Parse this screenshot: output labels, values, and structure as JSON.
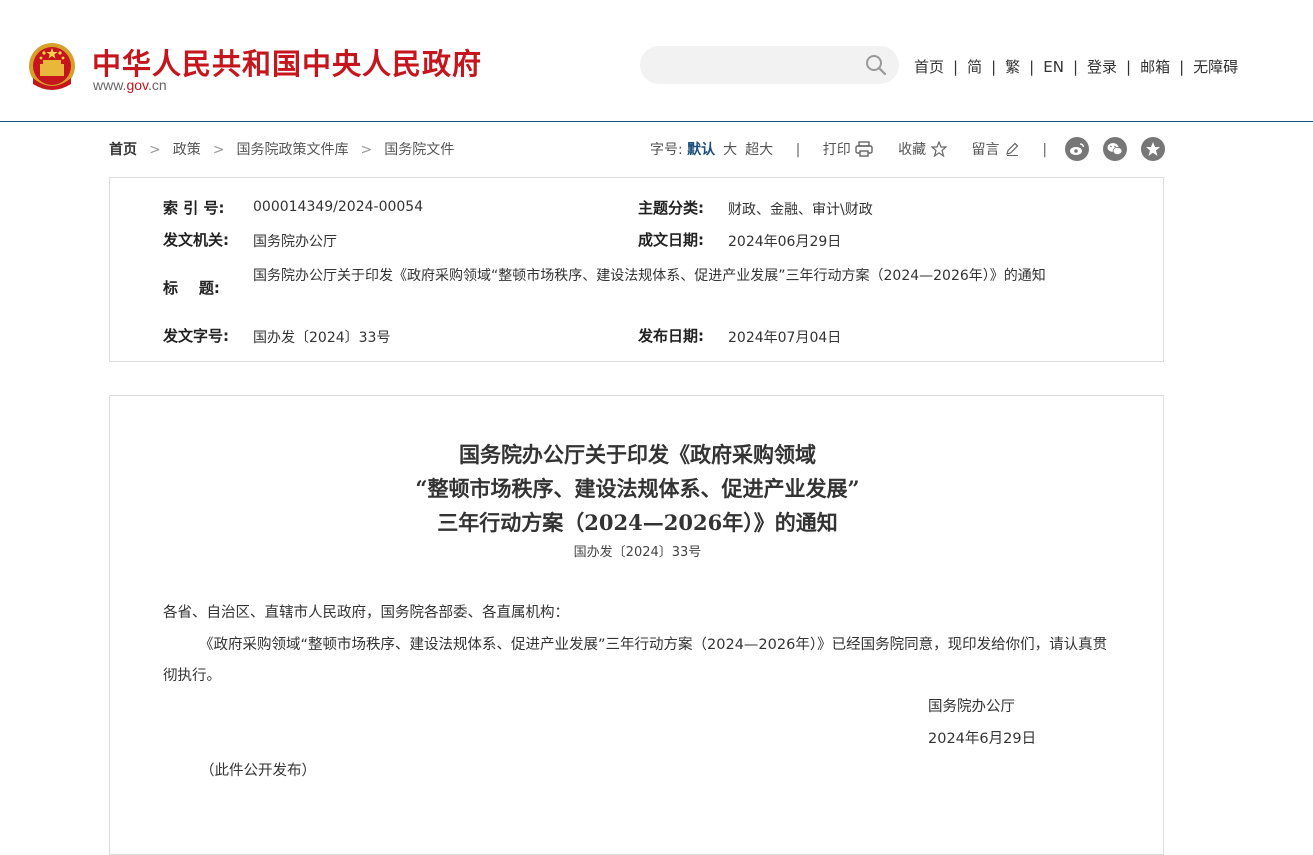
{
  "header": {
    "site_title": "中华人民共和国中央人民政府",
    "site_url_prefix": "www.",
    "site_url_brand": "gov",
    "site_url_suffix": ".cn",
    "search_placeholder": "",
    "nav": [
      "首页",
      "简",
      "繁",
      "EN",
      "登录",
      "邮箱",
      "无障碍"
    ]
  },
  "breadcrumb": [
    "首页",
    "政策",
    "国务院政策文件库",
    "国务院文件"
  ],
  "toolbar": {
    "font_label": "字号:",
    "font_sizes": [
      "默认",
      "大",
      "超大"
    ],
    "print": "打印",
    "favorite": "收藏",
    "comment": "留言"
  },
  "info": {
    "index_label": "索 引 号:",
    "index_value": "000014349/2024-00054",
    "topic_label": "主题分类:",
    "topic_value": "财政、金融、审计\\财政",
    "issuer_label": "发文机关:",
    "issuer_value": "国务院办公厅",
    "written_label": "成文日期:",
    "written_value": "2024年06月29日",
    "title_label": "标    题:",
    "title_value": "国务院办公厅关于印发《政府采购领域“整顿市场秩序、建设法规体系、促进产业发展”三年行动方案（2024—2026年）》的通知",
    "docno_label": "发文字号:",
    "docno_value": "国办发〔2024〕33号",
    "publish_label": "发布日期:",
    "publish_value": "2024年07月04日"
  },
  "article": {
    "title_line1": "国务院办公厅关于印发《政府采购领域",
    "title_line2": "“整顿市场秩序、建设法规体系、促进产业发展”",
    "title_line3": "三年行动方案（2024—2026年）》的通知",
    "doc_no": "国办发〔2024〕33号",
    "salutation": "各省、自治区、直辖市人民政府，国务院各部委、各直属机构：",
    "body": "《政府采购领域“整顿市场秩序、建设法规体系、促进产业发展”三年行动方案（2024—2026年）》已经国务院同意，现印发给你们，请认真贯彻执行。",
    "signature": "国务院办公厅",
    "date": "2024年6月29日",
    "note": "（此件公开发布）"
  },
  "colors": {
    "brand_red": "#c4161c",
    "nav_blue": "#1c4f7c"
  }
}
